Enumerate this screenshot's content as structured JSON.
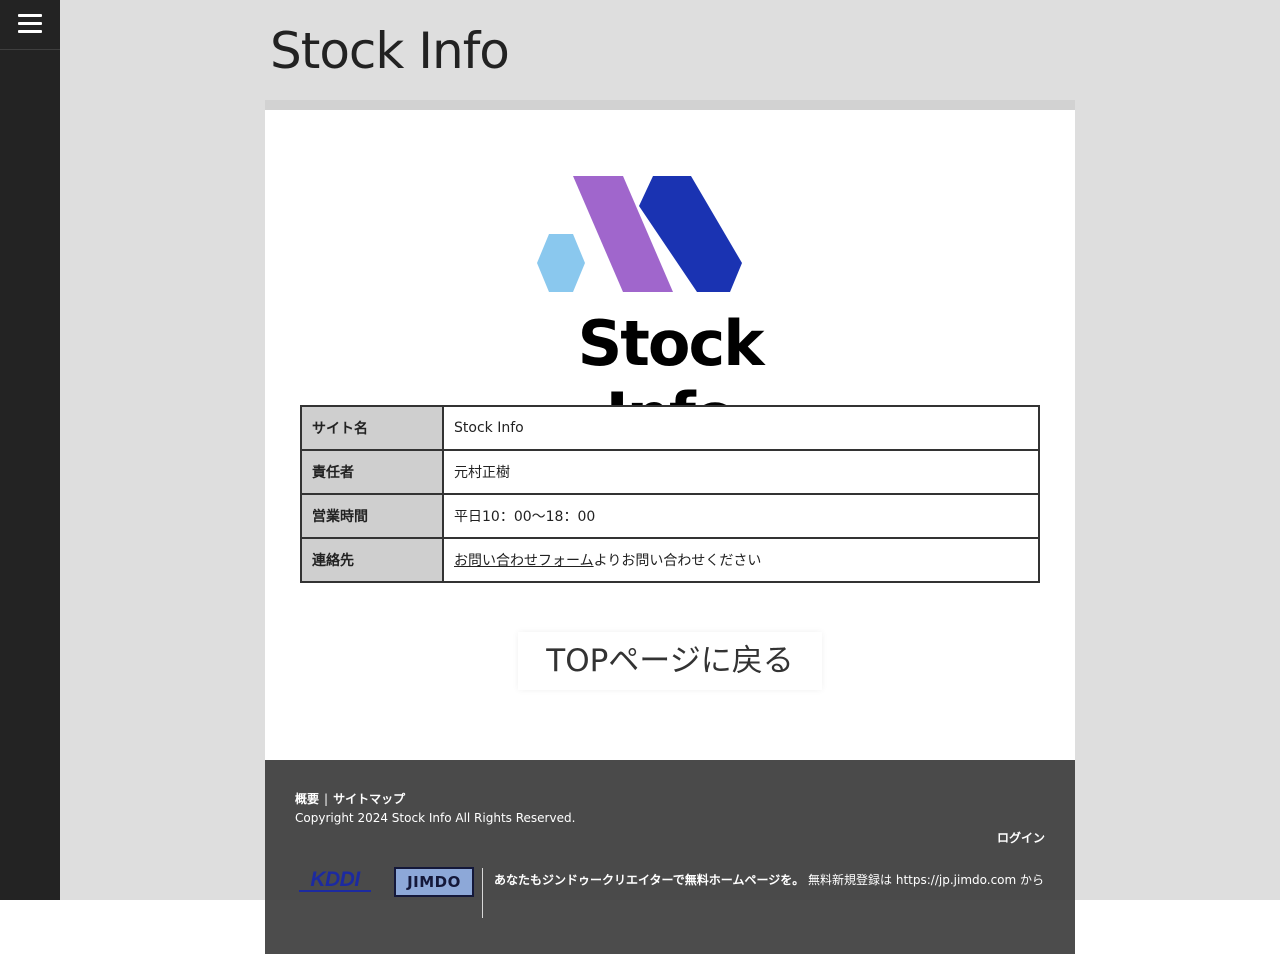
{
  "site": {
    "title": "Stock Info"
  },
  "menu": {
    "icon": "hamburger-icon"
  },
  "logo": {
    "text": "Stock Info",
    "colors": {
      "hex_light_blue": "#8ac8ee",
      "purple": "#a066cc",
      "dark_blue": "#1a33b2"
    }
  },
  "info_table": {
    "rows": [
      {
        "label": "サイト名",
        "value": "Stock Info"
      },
      {
        "label": "責任者",
        "value": "元村正樹"
      },
      {
        "label": "営業時間",
        "value": "平日10：00〜18：00"
      },
      {
        "label": "連絡先",
        "link_text": "お問い合わせフォーム",
        "value_suffix": "よりお問い合わせください"
      }
    ]
  },
  "top_button": {
    "label": "TOPページに戻る"
  },
  "footer": {
    "link_overview": "概要",
    "separator": "|",
    "link_sitemap": "サイトマップ",
    "copyright": "Copyright 2024 Stock Info All Rights Reserved.",
    "login": "ログイン",
    "kddi_logo_text": "KDDI",
    "jimdo_logo_text": "JIMDO",
    "promo_bold": "あなたもジンドゥークリエイターで無料ホームページを。",
    "promo_prefix": "無料新規登録は",
    "promo_url": "https://jp.jimdo.com",
    "promo_suffix": "から"
  },
  "colors": {
    "page_bg": "#dedede",
    "sidebar_bg": "#232323",
    "footer_bg": "#4a4a4a",
    "table_header_bg": "#cfcfcf"
  }
}
